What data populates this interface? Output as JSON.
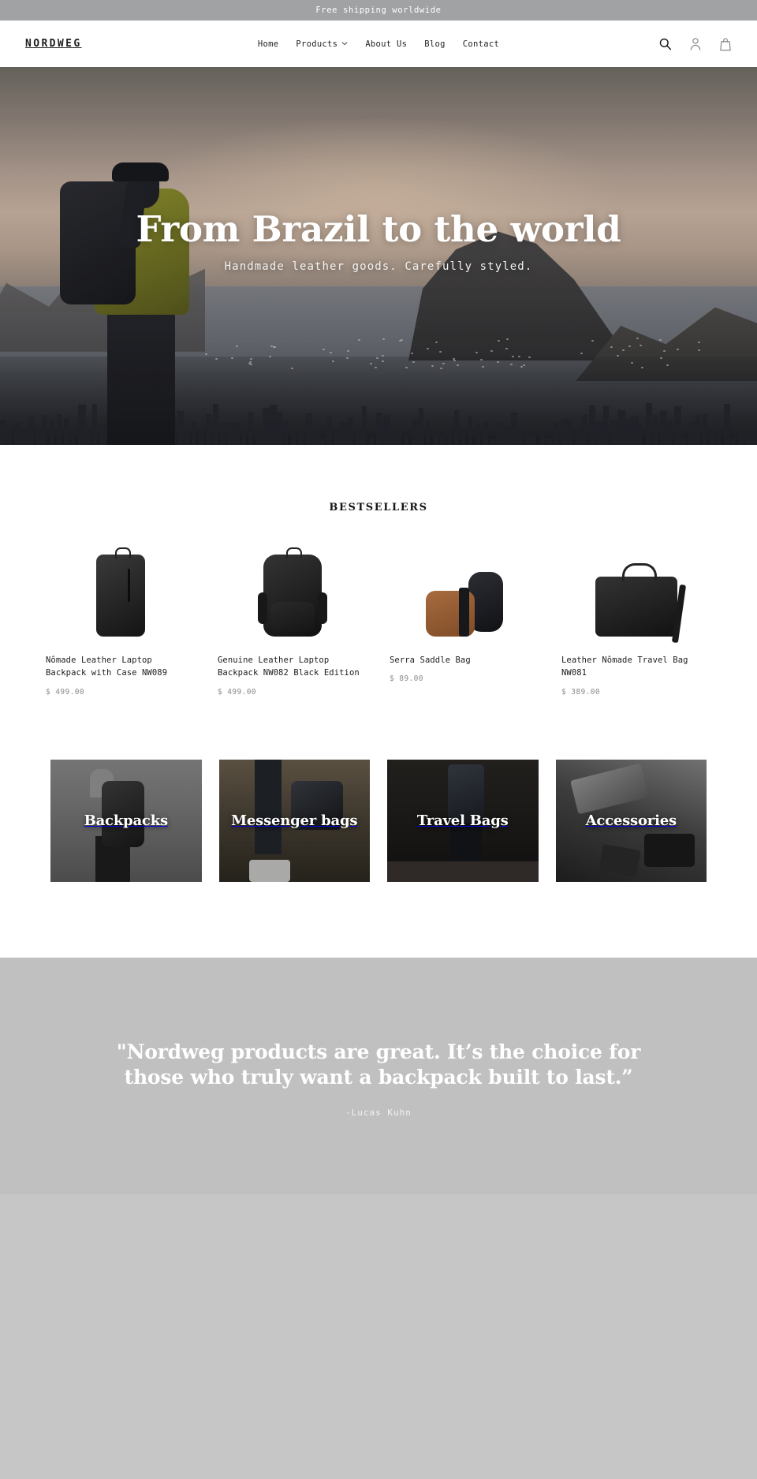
{
  "announcement": {
    "text": "Free shipping worldwide"
  },
  "header": {
    "brand": "NORDWEG",
    "nav": [
      {
        "label": "Home",
        "has_caret": false
      },
      {
        "label": "Products",
        "has_caret": true
      },
      {
        "label": "About Us",
        "has_caret": false
      },
      {
        "label": "Blog",
        "has_caret": false
      },
      {
        "label": "Contact",
        "has_caret": false
      }
    ],
    "actions": [
      {
        "icon": "search-icon",
        "name": "Search"
      },
      {
        "icon": "account-icon",
        "name": "Account"
      },
      {
        "icon": "cart-icon",
        "name": "Cart"
      }
    ]
  },
  "hero": {
    "title": "From Brazil to the world",
    "subtitle": "Handmade leather goods. Carefully styled."
  },
  "bestsellers": {
    "title": "BESTSELLERS",
    "products": [
      {
        "title": "Nômade Leather Laptop Backpack with Case NW089",
        "price": "$ 499.00",
        "art": "bag-a"
      },
      {
        "title": "Genuine Leather Laptop Backpack NW082 Black Edition",
        "price": "$ 499.00",
        "art": "bag-b"
      },
      {
        "title": "Serra Saddle Bag",
        "price": "$ 89.00",
        "art": "bag-c"
      },
      {
        "title": "Leather Nômade Travel Bag NW081",
        "price": "$ 389.00",
        "art": "bag-d"
      }
    ]
  },
  "categories": [
    {
      "label": "Backpacks"
    },
    {
      "label": "Messenger bags"
    },
    {
      "label": "Travel Bags"
    },
    {
      "label": "Accessories"
    }
  ],
  "testimonial": {
    "quote": "\"Nordweg products are great. It’s the choice for those who truly want a backpack built to last.”",
    "author": "-Lucas Kuhn"
  },
  "colors": {
    "announcement_bg": "#a0a2a4",
    "header_bg": "#ffffff",
    "page_bg": "#c6c6c6",
    "quote_bg": "#c0c0c0",
    "text_dark": "#1c1c1c",
    "text_muted": "#8a8a8a"
  }
}
